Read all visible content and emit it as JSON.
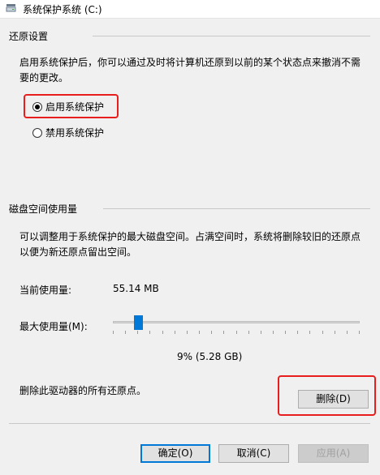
{
  "window": {
    "title": "系统保护系统 (C:)"
  },
  "restore": {
    "group_label": "还原设置",
    "description": "启用系统保护后，你可以通过及时将计算机还原到以前的某个状态点来撤消不需要的更改。",
    "options": [
      {
        "label": "启用系统保护",
        "checked": true
      },
      {
        "label": "禁用系统保护",
        "checked": false
      }
    ]
  },
  "disk": {
    "group_label": "磁盘空间使用量",
    "description": "可以调整用于系统保护的最大磁盘空间。占满空间时，系统将删除较旧的还原点以便为新还原点留出空间。",
    "current_usage_label": "当前使用量:",
    "current_usage_value": "55.14 MB",
    "max_usage_label": "最大使用量(M):",
    "max_usage_percent": 9,
    "max_usage_value": "9% (5.28 GB)",
    "delete_text": "删除此驱动器的所有还原点。",
    "delete_button": "删除(D)"
  },
  "buttons": {
    "ok": "确定(O)",
    "cancel": "取消(C)",
    "apply": "应用(A)"
  },
  "colors": {
    "accent": "#0078d7",
    "highlight": "#e81e1e"
  }
}
